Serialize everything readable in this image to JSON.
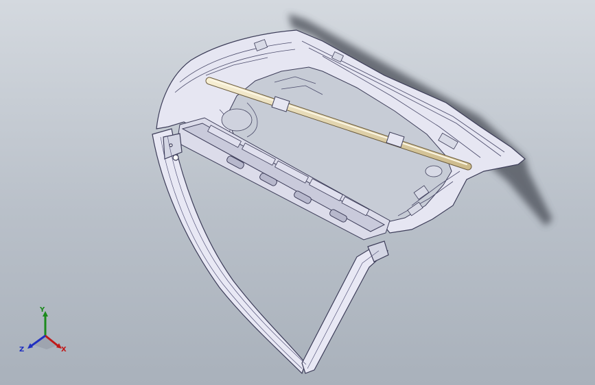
{
  "viewport": {
    "background_top": "#d4d9df",
    "background_bottom": "#a9b1bb",
    "model": "trunk-lid-assembly",
    "model_outline_color": "#3c3c58",
    "model_fill_color": "#e8e8f4",
    "strut_color": "#e9dcb4"
  },
  "triad": {
    "y_label": "Y",
    "x_label": "X",
    "z_label": "Z",
    "y_color": "#1c8a1c",
    "x_color": "#c01818",
    "z_color": "#2030c0"
  }
}
